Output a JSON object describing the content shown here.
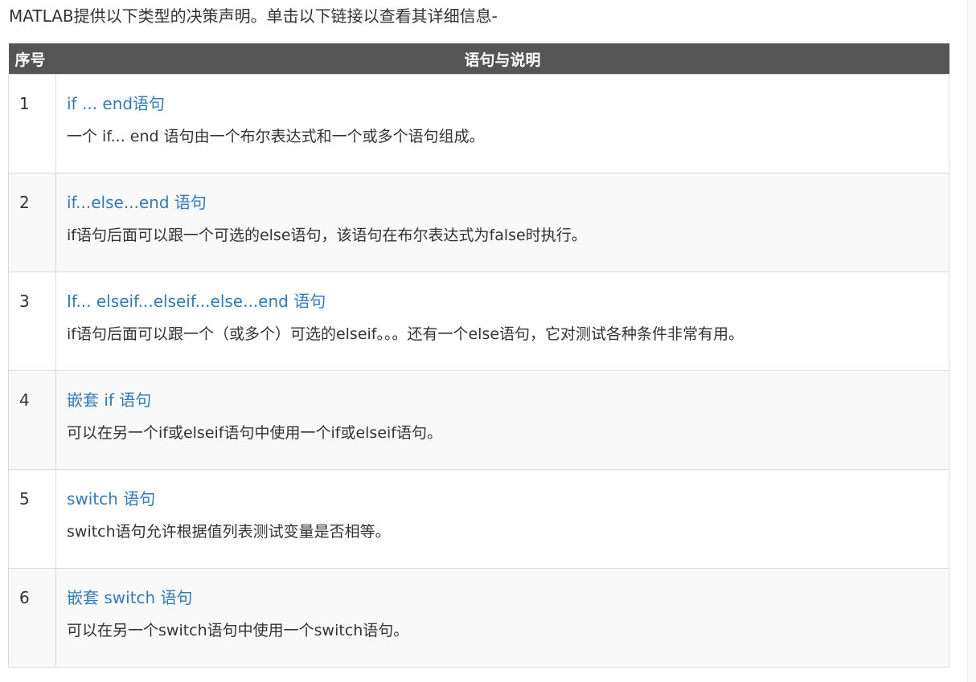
{
  "intro_text": "MATLAB提供以下类型的决策声明。单击以下链接以查看其详细信息-",
  "table": {
    "headers": {
      "number": "序号",
      "description": "语句与说明"
    },
    "rows": [
      {
        "number": "1",
        "link": "if ... end语句",
        "description": "一个 if... end 语句由一个布尔表达式和一个或多个语句组成。"
      },
      {
        "number": "2",
        "link": "if...else...end 语句",
        "description": "if语句后面可以跟一个可选的else语句，该语句在布尔表达式为false时执行。"
      },
      {
        "number": "3",
        "link": "If... elseif...elseif...else...end 语句",
        "description": "if语句后面可以跟一个（或多个）可选的elseif。。。还有一个else语句，它对测试各种条件非常有用。"
      },
      {
        "number": "4",
        "link": "嵌套 if 语句",
        "description": "可以在另一个if或elseif语句中使用一个if或elseif语句。"
      },
      {
        "number": "5",
        "link": "switch 语句",
        "description": "switch语句允许根据值列表测试变量是否相等。"
      },
      {
        "number": "6",
        "link": "嵌套 switch 语句",
        "description": "可以在另一个switch语句中使用一个switch语句。"
      }
    ]
  },
  "colors": {
    "header_bg": "#555555",
    "link": "#337ab7",
    "text": "#333333",
    "row_alt": "#f9f9f9",
    "border": "#dddddd"
  }
}
